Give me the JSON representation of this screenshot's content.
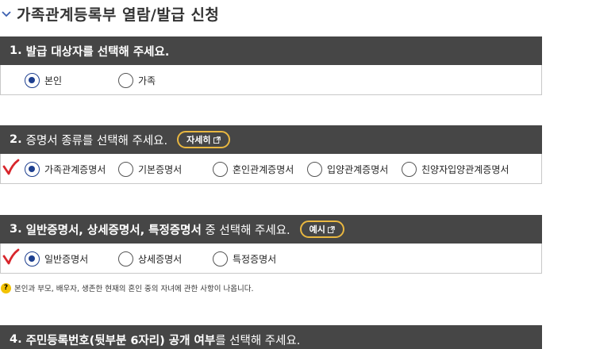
{
  "page": {
    "title": "가족관계등록부 열람/발급 신청"
  },
  "sections": [
    {
      "number": "1.",
      "heading": "발급 대상자를 선택해 주세요.",
      "options": [
        {
          "label": "본인",
          "selected": true
        },
        {
          "label": "가족",
          "selected": false
        }
      ]
    },
    {
      "number": "2.",
      "heading": "증명서 종류를 선택해 주세요.",
      "button": "자세히",
      "options": [
        {
          "label": "가족관계증명서",
          "selected": true
        },
        {
          "label": "기본증명서",
          "selected": false
        },
        {
          "label": "혼인관계증명서",
          "selected": false
        },
        {
          "label": "입양관계증명서",
          "selected": false
        },
        {
          "label": "친양자입양관계증명서",
          "selected": false
        }
      ]
    },
    {
      "number": "3.",
      "heading_bold": "일반증명서, 상세증명서, 특정증명서",
      "heading_rest": " 중 선택해 주세요.",
      "button": "예시",
      "options": [
        {
          "label": "일반증명서",
          "selected": true
        },
        {
          "label": "상세증명서",
          "selected": false
        },
        {
          "label": "특정증명서",
          "selected": false
        }
      ]
    },
    {
      "number": "4.",
      "heading_bold": "주민등록번호(뒷부분 6자리) 공개 여부",
      "heading_rest": "를 선택해 주세요."
    }
  ],
  "note": {
    "icon": "question-icon",
    "glyph": "?",
    "text": "본인과 부모, 배우자, 생존한 현재의 혼인 중의 자녀에 관한 사항이 나옵니다."
  },
  "colors": {
    "header_bg": "#464646",
    "radio_selected": "#1d3f8f",
    "pill_border": "#e9b740",
    "check_mark": "#d8262c"
  }
}
